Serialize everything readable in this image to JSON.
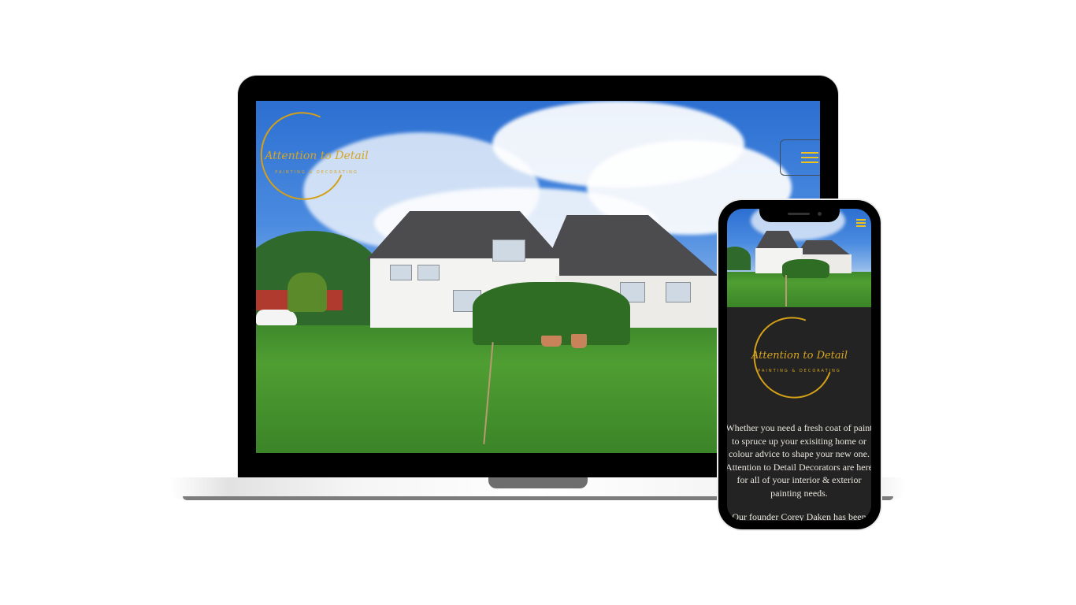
{
  "site": {
    "brand_script": "Attention to Detail",
    "brand_tagline": "PAINTING & DECORATING"
  },
  "phone": {
    "intro_paragraph": "Whether you need a fresh coat of paint to spruce up your exisiting home or colour advice to shape your new one. Attention to Detail Decorators are here for all of your interior & exterior painting needs.",
    "second_paragraph_start": "Our founder Corey Daken has been"
  },
  "colors": {
    "accent_gold": "#d4a017",
    "menu_icon": "#f0c219",
    "dark_section": "#232323"
  },
  "icons": {
    "menu": "hamburger-icon"
  }
}
